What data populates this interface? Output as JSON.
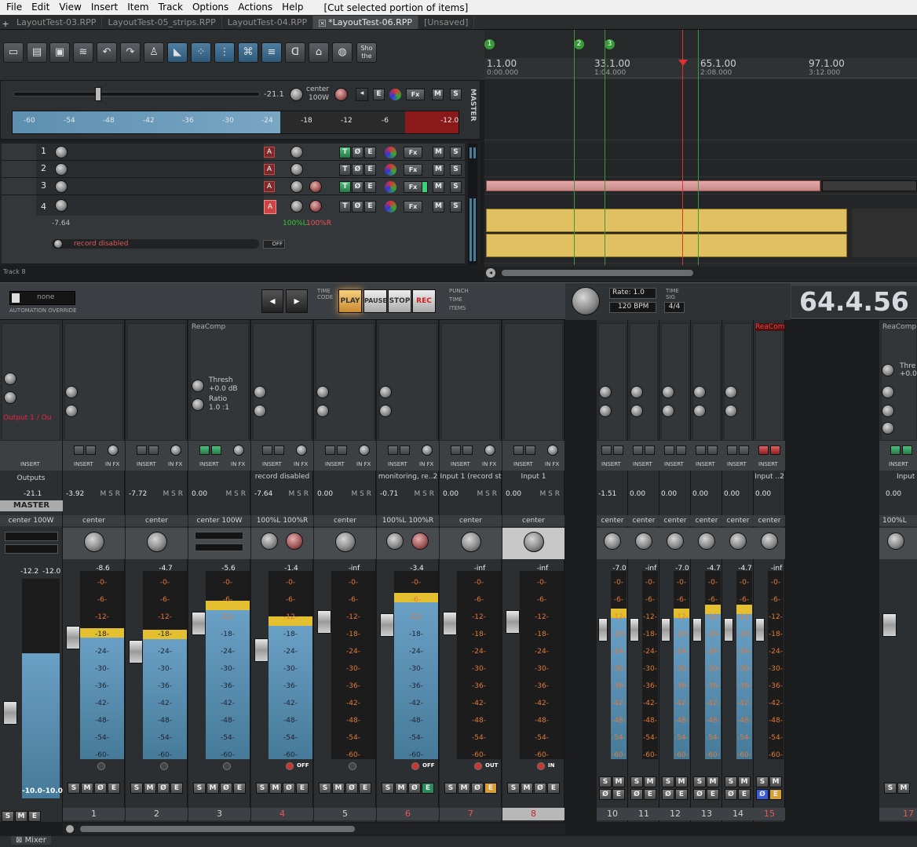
{
  "menu": [
    "File",
    "Edit",
    "View",
    "Insert",
    "Item",
    "Track",
    "Options",
    "Actions",
    "Help"
  ],
  "status_text": "[Cut selected portion of items]",
  "tabs": [
    {
      "label": "LayoutTest-03.RPP",
      "active": false
    },
    {
      "label": "LayoutTest-05_strips.RPP",
      "active": false
    },
    {
      "label": "LayoutTest-04.RPP",
      "active": false
    },
    {
      "label": "*LayoutTest-06.RPP",
      "active": true
    },
    {
      "label": "[Unsaved]",
      "active": false
    }
  ],
  "toolbar": {
    "show_label": "Sho the"
  },
  "master_tcp": {
    "volume": "-21.1",
    "pan_label": "center",
    "pan_width": "100W",
    "side_label": "MASTER",
    "meter_ticks": [
      "-60",
      "-54",
      "-48",
      "-42",
      "-36",
      "-30",
      "-24",
      "-18",
      "-12",
      "-6",
      "-12.0"
    ],
    "buttons": {
      "e": "E",
      "fx": "Fx",
      "m": "M",
      "s": "S"
    }
  },
  "tracks": [
    {
      "num": "1",
      "fx": "Fx",
      "m": "M",
      "s": "S"
    },
    {
      "num": "2",
      "fx": "Fx",
      "m": "M",
      "s": "S"
    },
    {
      "num": "3",
      "fx": "Fx",
      "m": "M",
      "s": "S"
    },
    {
      "num": "4",
      "fx": "Fx",
      "m": "M",
      "s": "S",
      "volume": "-7.64",
      "pan": "100%L",
      "width": "100%R",
      "rec_label": "record disabled",
      "off": "OFF"
    }
  ],
  "track8_label": "Track 8",
  "ruler": [
    {
      "bar": "1.1.00",
      "time": "0:00.000"
    },
    {
      "bar": "33.1.00",
      "time": "1:04.000"
    },
    {
      "bar": "65.1.00",
      "time": "2:08.000"
    },
    {
      "bar": "97.1.00",
      "time": "3:12.000"
    }
  ],
  "markers": [
    "1",
    "2",
    "3"
  ],
  "transport": {
    "automation_mode": "none",
    "automation_label": "AUTOMATION OVERRIDE",
    "timecode_label": "TIME CODE",
    "play": "PLAY",
    "pause": "PAUSE",
    "stop": "STOP",
    "rec": "REC",
    "punch": [
      "PUNCH",
      "TIME",
      "ITEMS"
    ],
    "rate_label": "Rate:",
    "rate": "1.0",
    "bpm": "120",
    "bpm_label": "BPM",
    "timesig_label": "TIME SIG",
    "timesig": "4/4",
    "time": "64.4.56"
  },
  "mixer": {
    "master": {
      "outputs": "Outputs",
      "output_label": "Output 1 / Ou",
      "vol": "-21.1",
      "name": "MASTER",
      "pan": "center",
      "width": "100W",
      "peakL": "-12.2",
      "peakR": "-12.0",
      "footL": "-10.0",
      "footR": "-10.0"
    },
    "io_labels": {
      "insert": "INSERT",
      "infx": "IN FX"
    },
    "fx_names": {
      "reacomp": "ReaComp",
      "thresh": "Thresh",
      "thresh_val": "+0.0 dB",
      "ratio": "Ratio",
      "ratio_val": "1.0 :1",
      "reacomp_short": "ReaCom",
      "reacomp_r": "ReaComp",
      "thresh_r": "Thre",
      "thresh_r_val": "+0.0"
    },
    "strips": [
      {
        "num": "1",
        "vol": "-3.92",
        "pan": "center",
        "peak": "-8.6",
        "label": ""
      },
      {
        "num": "2",
        "vol": "-7.72",
        "pan": "center",
        "peak": "-4.7",
        "label": ""
      },
      {
        "num": "3",
        "vol": "0.00",
        "pan": "center",
        "width": "100W",
        "peak": "-5.6",
        "label": ""
      },
      {
        "num": "4",
        "vol": "-7.64",
        "pan": "100%L",
        "width": "100%R",
        "peak": "-1.4",
        "label": "record disabled",
        "foot": "OFF"
      },
      {
        "num": "5",
        "vol": "0.00",
        "pan": "center",
        "peak": "-inf",
        "label": ""
      },
      {
        "num": "6",
        "vol": "-0.71",
        "pan": "100%L",
        "width": "100%R",
        "peak": "-3.4",
        "label": "monitoring, re..2",
        "foot": "OFF"
      },
      {
        "num": "7",
        "vol": "0.00",
        "pan": "center",
        "peak": "-inf",
        "label": "Input 1 (record st",
        "foot": "OUT"
      },
      {
        "num": "8",
        "vol": "0.00",
        "pan": "center",
        "peak": "-inf",
        "label": "Input 1",
        "foot": "IN"
      }
    ],
    "narrow_strips": [
      {
        "num": "10",
        "vol": "-1.51",
        "pan": "center",
        "peak": "-7.0"
      },
      {
        "num": "11",
        "vol": "0.00",
        "pan": "center",
        "peak": "-inf"
      },
      {
        "num": "12",
        "vol": "0.00",
        "pan": "center",
        "peak": "-7.0"
      },
      {
        "num": "13",
        "vol": "0.00",
        "pan": "center",
        "peak": "-4.7"
      },
      {
        "num": "14",
        "vol": "0.00",
        "pan": "center",
        "peak": "-4.7"
      },
      {
        "num": "15",
        "vol": "0.00",
        "pan": "center",
        "peak": "-inf",
        "label": "Input ..2"
      }
    ],
    "far_strip": {
      "num": "17",
      "vol": "0.00",
      "pan": "100%L",
      "label": "Input"
    },
    "scale": [
      "-0-",
      "-6-",
      "-12-",
      "-18-",
      "-24-",
      "-30-",
      "-36-",
      "-42-",
      "-48-",
      "-54-",
      "-60-"
    ],
    "btn_labels": [
      "S",
      "M",
      "Ø",
      "E"
    ],
    "mixer_tab": "Mixer"
  }
}
